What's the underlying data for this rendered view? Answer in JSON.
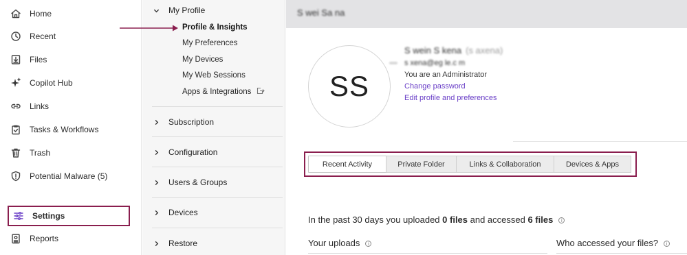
{
  "sidebar": {
    "items": [
      {
        "label": "Home",
        "icon": "home-icon"
      },
      {
        "label": "Recent",
        "icon": "clock-icon"
      },
      {
        "label": "Files",
        "icon": "files-icon"
      },
      {
        "label": "Copilot Hub",
        "icon": "sparkle-icon"
      },
      {
        "label": "Links",
        "icon": "link-icon"
      },
      {
        "label": "Tasks & Workflows",
        "icon": "clipboard-check-icon"
      },
      {
        "label": "Trash",
        "icon": "trash-icon"
      },
      {
        "label": "Potential Malware (5)",
        "icon": "shield-alert-icon"
      },
      {
        "label": "Settings",
        "icon": "sliders-icon",
        "selected": true
      },
      {
        "label": "Reports",
        "icon": "report-icon"
      }
    ]
  },
  "settings_nav": {
    "my_profile": {
      "label": "My Profile",
      "items": [
        {
          "label": "Profile & Insights",
          "active": true
        },
        {
          "label": "My Preferences"
        },
        {
          "label": "My Devices"
        },
        {
          "label": "My Web Sessions"
        },
        {
          "label": "Apps & Integrations",
          "icon": "external-icon"
        }
      ]
    },
    "sections": [
      "Subscription",
      "Configuration",
      "Users & Groups",
      "Devices",
      "Restore"
    ]
  },
  "main": {
    "top_title": "S wei Sa na",
    "avatar_initials": "SS",
    "user_name": "S wein S kena",
    "user_handle": "(s axena)",
    "email": "s xena@eg le.c m",
    "role": "You are an Administrator",
    "change_password": "Change password",
    "edit_profile": "Edit profile and preferences",
    "tabs": [
      {
        "label": "Recent Activity",
        "active": true
      },
      {
        "label": "Private Folder"
      },
      {
        "label": "Links & Collaboration"
      },
      {
        "label": "Devices & Apps"
      }
    ],
    "summary": {
      "prefix": "In the past 30 days you uploaded ",
      "uploaded": "0 files",
      "middle": " and accessed ",
      "accessed": "6 files"
    },
    "uploads_heading": "Your uploads",
    "accessed_heading": "Who accessed your files?"
  },
  "colors": {
    "highlight_border": "#8a1e4e",
    "link": "#6a3fc7",
    "top_bar": "#e3e3e5"
  }
}
